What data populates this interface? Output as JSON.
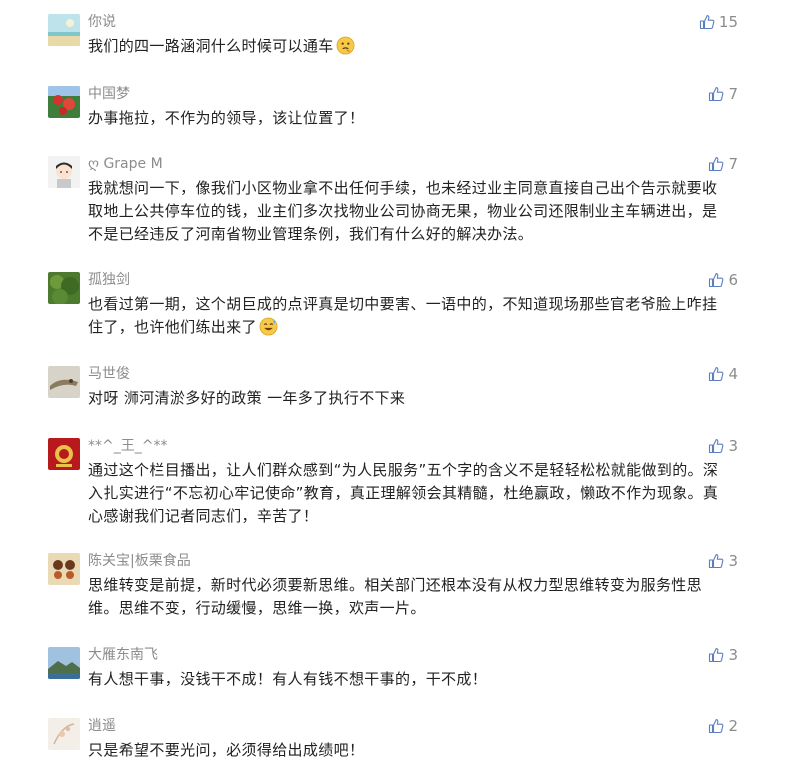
{
  "colors": {
    "name": "#8c8c8c",
    "text": "#222222",
    "like_icon": "#5a7ec0"
  },
  "like_icon_name": "thumbs-up-icon",
  "comments": [
    {
      "name": "你说",
      "likes": "15",
      "text": "我们的四一路涵洞什么时候可以通车",
      "emoji": "thinking-face-icon"
    },
    {
      "name": "中国梦",
      "likes": "7",
      "text": "办事拖拉，不作为的领导，该让位置了！"
    },
    {
      "name": "ღ Grape M",
      "likes": "7",
      "text": "我就想问一下，像我们小区物业拿不出任何手续，也未经过业主同意直接自己出个告示就要收取地上公共停车位的钱，业主们多次找物业公司协商无果，物业公司还限制业主车辆进出，是不是已经违反了河南省物业管理条例，我们有什么好的解决办法。"
    },
    {
      "name": "孤独剑",
      "likes": "6",
      "text": "也看过第一期，这个胡巨成的点评真是切中要害、一语中的，不知道现场那些官老爷脸上咋挂住了，也许他们练出来了",
      "emoji": "grinning-sweat-icon"
    },
    {
      "name": "马世俊",
      "likes": "4",
      "text": "对呀 浉河清淤多好的政策 一年多了执行不下来"
    },
    {
      "name": "**^_王_^**",
      "likes": "3",
      "text": "通过这个栏目播出，让人们群众感到“为人民服务”五个字的含义不是轻轻松松就能做到的。深入扎实进行“不忘初心牢记使命”教育，真正理解领会其精髓，杜绝赢政，懒政不作为现象。真心感谢我们记者同志们，辛苦了！"
    },
    {
      "name": "陈关宝|板栗食品",
      "likes": "3",
      "text": "思维转变是前提，新时代必须要新思维。相关部门还根本没有从权力型思维转变为服务性思维。思维不变，行动缓慢，思维一换，欢声一片。"
    },
    {
      "name": "大雁东南飞",
      "likes": "3",
      "text": "有人想干事，没钱干不成！有人有钱不想干事的，干不成！"
    },
    {
      "name": "逍遥",
      "likes": "2",
      "text": "只是希望不要光问，必须得给出成绩吧！"
    }
  ]
}
